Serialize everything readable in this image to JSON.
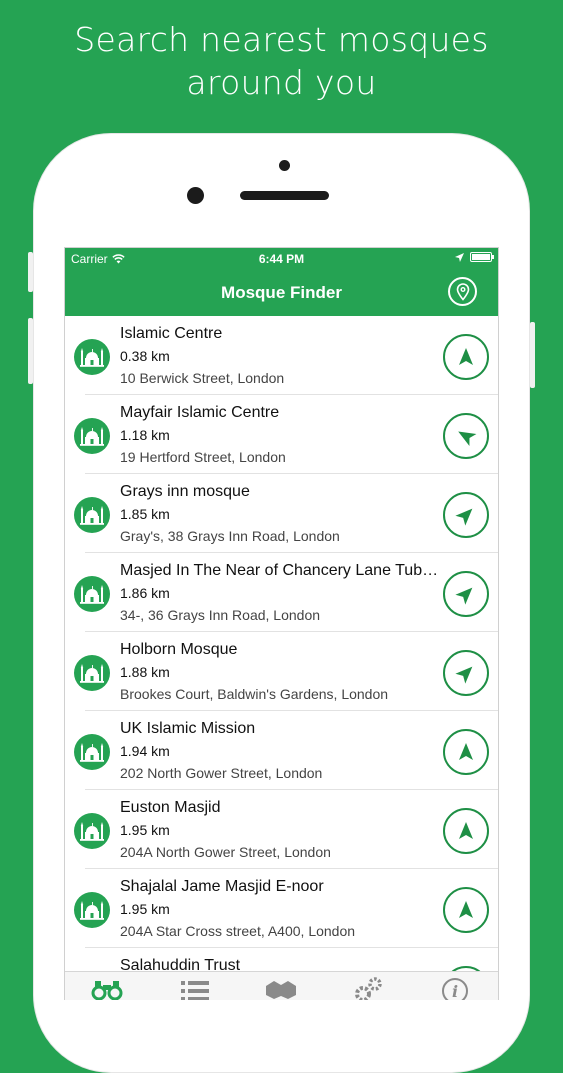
{
  "headline": {
    "line1": "Search nearest mosques",
    "line2": "around you"
  },
  "status_bar": {
    "carrier": "Carrier",
    "time": "6:44 PM"
  },
  "nav": {
    "title": "Mosque Finder"
  },
  "colors": {
    "brand": "#25a353",
    "accent": "#1e8f45"
  },
  "mosques": [
    {
      "name": "Islamic Centre",
      "distance": "0.38 km",
      "address": "10 Berwick Street, London",
      "bearing": 0
    },
    {
      "name": "Mayfair Islamic Centre",
      "distance": "1.18 km",
      "address": "19 Hertford Street, London",
      "bearing": -60
    },
    {
      "name": "Grays inn mosque",
      "distance": "1.85 km",
      "address": "Gray's, 38 Grays Inn Road, London",
      "bearing": 45
    },
    {
      "name": "Masjed In The Near of Chancery Lane Tube Station",
      "distance": "1.86 km",
      "address": "34-, 36 Grays Inn Road, London",
      "bearing": 45
    },
    {
      "name": "Holborn Mosque",
      "distance": "1.88 km",
      "address": "Brookes Court, Baldwin's Gardens, London",
      "bearing": 45
    },
    {
      "name": "UK Islamic Mission",
      "distance": "1.94 km",
      "address": "202 North Gower Street, London",
      "bearing": 0
    },
    {
      "name": "Euston Masjid",
      "distance": "1.95 km",
      "address": "204A North Gower Street, London",
      "bearing": 0
    },
    {
      "name": "Shajalal Jame Masjid E-noor",
      "distance": "1.95 km",
      "address": "204A Star Cross street, A400, London",
      "bearing": 0
    },
    {
      "name": "Salahuddin Trust",
      "distance": "",
      "address": "",
      "bearing": 0
    }
  ],
  "tabs": [
    {
      "icon": "binoculars-icon"
    },
    {
      "icon": "list-icon"
    },
    {
      "icon": "handshake-icon"
    },
    {
      "icon": "gears-icon"
    },
    {
      "icon": "info-icon"
    }
  ]
}
